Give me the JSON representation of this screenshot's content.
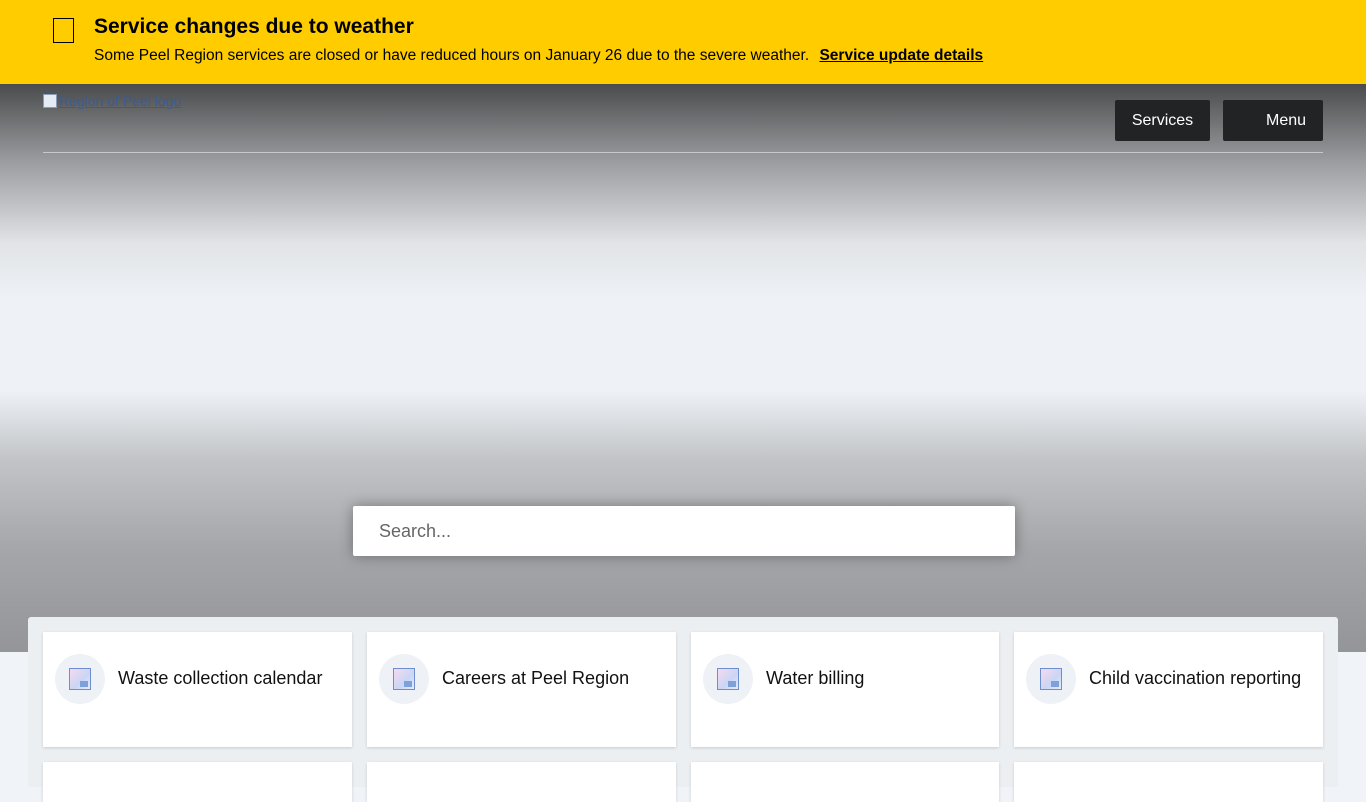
{
  "alert": {
    "title": "Service changes due to weather",
    "message": "Some Peel Region services are closed or have reduced hours on January 26 due to the severe weather.",
    "link_label": "Service update details"
  },
  "header": {
    "logo_alt": "Region of Peel logo",
    "services_label": "Services",
    "menu_label": "Menu"
  },
  "search": {
    "placeholder": "Search..."
  },
  "quick_links": [
    {
      "label": "Waste collection calendar",
      "icon": "broken-image-icon"
    },
    {
      "label": "Careers at Peel Region",
      "icon": "broken-image-icon"
    },
    {
      "label": "Water billing",
      "icon": "broken-image-icon"
    },
    {
      "label": "Child vaccination reporting",
      "icon": "broken-image-icon"
    }
  ],
  "colors": {
    "alert_bg": "#ffcc00",
    "nav_button_bg": "#222324"
  }
}
